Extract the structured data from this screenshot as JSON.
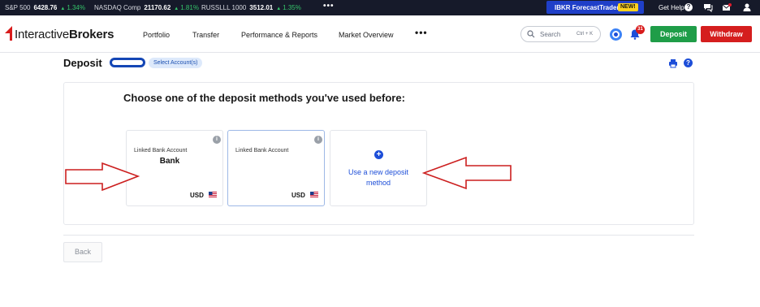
{
  "ticker": {
    "items": [
      {
        "symbol": "S&P 500",
        "value": "6428.76",
        "change": "1.34%"
      },
      {
        "symbol": "NASDAQ Comp",
        "value": "21170.62",
        "change": "1.81%"
      },
      {
        "symbol": "RUSSLLL 1000",
        "value": "3512.01",
        "change": "1.35%"
      }
    ],
    "more": "•••",
    "forecast_label": "IBKR ForecastTrader",
    "new_badge": "NEW!",
    "get_help": "Get Help",
    "help_glyph": "?"
  },
  "nav": {
    "logo_bold": "Interactive",
    "logo_rest": "Brokers",
    "items": [
      "Portfolio",
      "Transfer",
      "Performance & Reports",
      "Market Overview"
    ],
    "more": "•••",
    "search_placeholder": "Search",
    "search_shortcut": "Ctrl + K",
    "notification_count": "31",
    "deposit_label": "Deposit",
    "withdraw_label": "Withdraw"
  },
  "page": {
    "title": "Deposit",
    "select_accounts": "Select Account(s)",
    "help_glyph": "?"
  },
  "main": {
    "heading": "Choose one of the deposit methods you've used before:",
    "cards": [
      {
        "type": "Linked Bank Account",
        "name": "Bank",
        "currency": "USD",
        "info": "i"
      },
      {
        "type": "Linked Bank Account",
        "name": "",
        "currency": "USD",
        "info": "i"
      }
    ],
    "new_method": {
      "plus": "+",
      "label": "Use a new deposit method"
    },
    "back_label": "Back"
  },
  "colors": {
    "ticker_bg": "#161a2a",
    "gain": "#35c46a",
    "forecast_bg": "#1f3fc8",
    "deposit_green": "#1f9d48",
    "withdraw_red": "#d51e1e",
    "link_blue": "#1d4ed8",
    "annotation_arrow": "#cc1f1f"
  },
  "icons": [
    "help-icon",
    "chat-icon",
    "mail-icon",
    "user-icon",
    "search-icon",
    "notification-bell-icon",
    "print-icon",
    "info-icon",
    "plus-icon",
    "us-flag-icon"
  ]
}
